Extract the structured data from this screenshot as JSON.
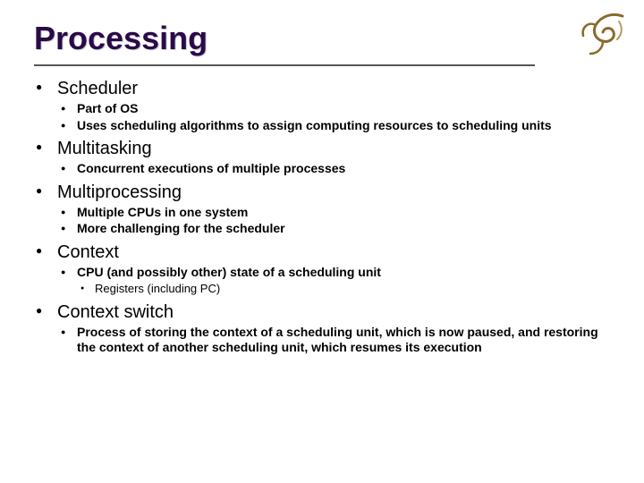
{
  "title": "Processing",
  "bullets": {
    "b0": "Scheduler",
    "b0_0": "Part of OS",
    "b0_1": "Uses scheduling algorithms to assign computing resources to scheduling units",
    "b1": "Multitasking",
    "b1_0": "Concurrent executions of multiple processes",
    "b2": "Multiprocessing",
    "b2_0": "Multiple CPUs in one system",
    "b2_1": "More challenging for the scheduler",
    "b3": "Context",
    "b3_0": "CPU (and possibly other) state of a scheduling unit",
    "b3_0_0": "Registers (including PC)",
    "b4": "Context switch",
    "b4_0": "Process of storing the context of a scheduling unit, which is now paused, and restoring the context of another scheduling unit, which resumes its execution"
  }
}
